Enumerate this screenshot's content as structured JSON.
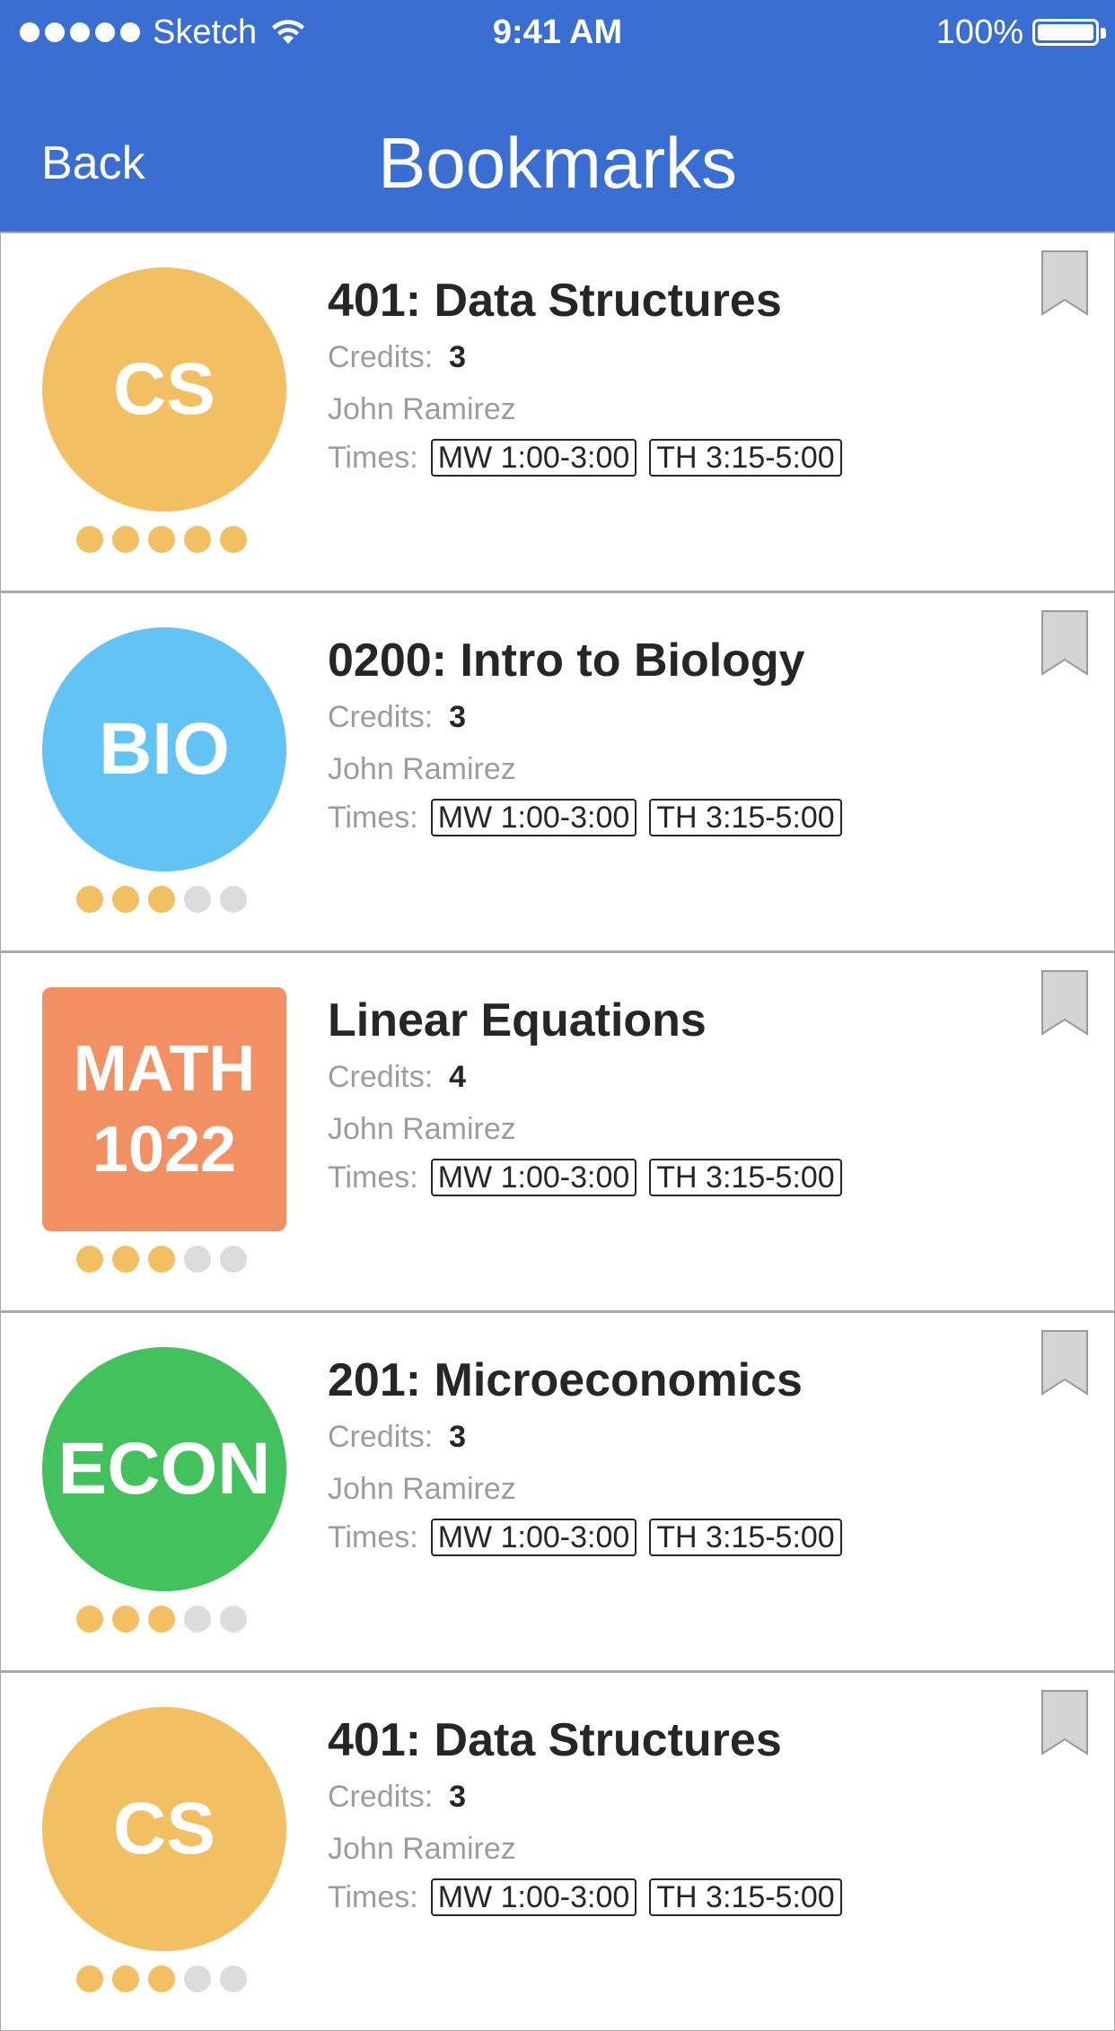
{
  "status_bar": {
    "carrier": "Sketch",
    "time": "9:41 AM",
    "battery": "100%"
  },
  "nav": {
    "back_label": "Back",
    "title": "Bookmarks"
  },
  "labels": {
    "credits": "Credits:",
    "times": "Times:"
  },
  "colors": {
    "header": "#3a6ed3",
    "rating_on": "#f2c063",
    "rating_off": "#dcdcdc"
  },
  "courses": [
    {
      "badge": "CS",
      "badge_shape": "circle",
      "badge_color": "#f2c063",
      "title": "401: Data Structures",
      "credits": "3",
      "instructor": "John Ramirez",
      "times": [
        "MW 1:00-3:00",
        "TH 3:15-5:00"
      ],
      "rating": 5,
      "rating_max": 5,
      "bookmark_icon": "bookmark-icon"
    },
    {
      "badge": "BIO",
      "badge_shape": "circle",
      "badge_color": "#63c3f4",
      "title": "0200: Intro to Biology",
      "credits": "3",
      "instructor": "John Ramirez",
      "times": [
        "MW 1:00-3:00",
        "TH 3:15-5:00"
      ],
      "rating": 3,
      "rating_max": 5,
      "bookmark_icon": "bookmark-icon"
    },
    {
      "badge": "MATH\n1022",
      "badge_shape": "square",
      "badge_color": "#f28f63",
      "title": "Linear Equations",
      "credits": "4",
      "instructor": "John Ramirez",
      "times": [
        "MW 1:00-3:00",
        "TH 3:15-5:00"
      ],
      "rating": 3,
      "rating_max": 5,
      "bookmark_icon": "bookmark-icon"
    },
    {
      "badge": "ECON",
      "badge_shape": "circle",
      "badge_color": "#43c15c",
      "title": "201: Microeconomics",
      "credits": "3",
      "instructor": "John Ramirez",
      "times": [
        "MW 1:00-3:00",
        "TH 3:15-5:00"
      ],
      "rating": 3,
      "rating_max": 5,
      "bookmark_icon": "bookmark-icon"
    },
    {
      "badge": "CS",
      "badge_shape": "circle",
      "badge_color": "#f2c063",
      "title": "401: Data Structures",
      "credits": "3",
      "instructor": "John Ramirez",
      "times": [
        "MW 1:00-3:00",
        "TH 3:15-5:00"
      ],
      "rating": 3,
      "rating_max": 5,
      "bookmark_icon": "bookmark-icon"
    }
  ]
}
